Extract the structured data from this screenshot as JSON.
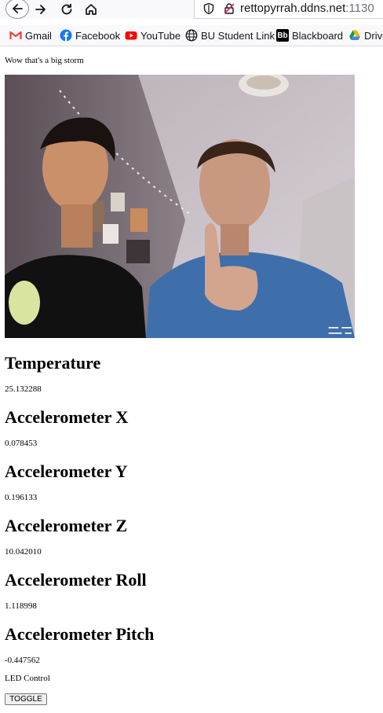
{
  "browser": {
    "url_host": "rettopyrrah.ddns.net",
    "url_port": ":1130",
    "bookmarks": [
      {
        "label": "Gmail",
        "icon": "gmail-icon"
      },
      {
        "label": "Facebook",
        "icon": "facebook-icon"
      },
      {
        "label": "YouTube",
        "icon": "youtube-icon"
      },
      {
        "label": "BU Student Link",
        "icon": "globe-icon"
      },
      {
        "label": "Blackboard",
        "icon": "blackboard-icon"
      },
      {
        "label": "Drive",
        "icon": "drive-icon"
      }
    ],
    "blackboard_icon_text": "Bb"
  },
  "page": {
    "caption": "Wow that's a big storm",
    "sensors": [
      {
        "title": "Temperature",
        "value": "25.132288"
      },
      {
        "title": "Accelerometer X",
        "value": "0.078453"
      },
      {
        "title": "Accelerometer Y",
        "value": "0.196133"
      },
      {
        "title": "Accelerometer Z",
        "value": "10.042010"
      },
      {
        "title": "Accelerometer Roll",
        "value": "1.118998"
      },
      {
        "title": "Accelerometer Pitch",
        "value": "-0.447562"
      }
    ],
    "led_label": "LED Control",
    "toggle_label": "TOGGLE"
  },
  "colors": {
    "gmail_red": "#ea4335",
    "facebook_blue": "#1877f2",
    "youtube_red": "#ff0000",
    "drive_green": "#0f9d58",
    "drive_yellow": "#f4b400",
    "drive_blue": "#4285f4"
  }
}
